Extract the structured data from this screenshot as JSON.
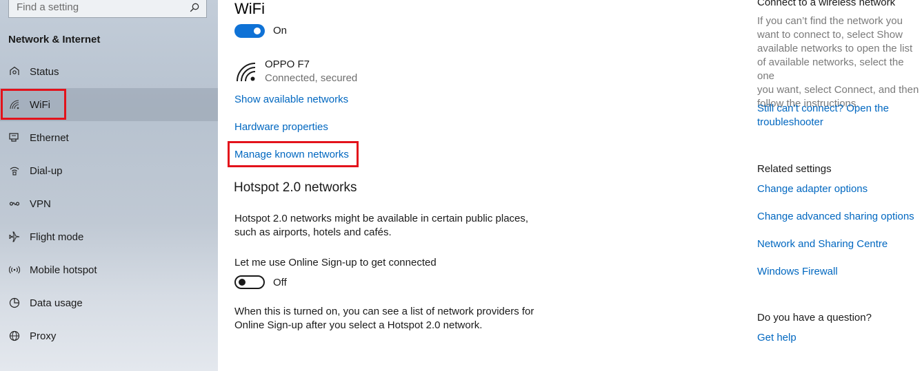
{
  "sidebar": {
    "search_placeholder": "Find a setting",
    "section_title": "Network & Internet",
    "items": [
      {
        "label": "Status",
        "icon": "home-status-icon"
      },
      {
        "label": "WiFi",
        "icon": "wifi-icon"
      },
      {
        "label": "Ethernet",
        "icon": "ethernet-icon"
      },
      {
        "label": "Dial-up",
        "icon": "dial-up-icon"
      },
      {
        "label": "VPN",
        "icon": "vpn-icon"
      },
      {
        "label": "Flight mode",
        "icon": "airplane-icon"
      },
      {
        "label": "Mobile hotspot",
        "icon": "hotspot-icon"
      },
      {
        "label": "Data usage",
        "icon": "data-usage-icon"
      },
      {
        "label": "Proxy",
        "icon": "globe-icon"
      }
    ],
    "selected": "WiFi"
  },
  "main": {
    "title": "WiFi",
    "wifi_toggle_label": "On",
    "network": {
      "name": "OPPO F7",
      "status": "Connected, secured"
    },
    "links": {
      "show_networks": "Show available networks",
      "hardware": "Hardware properties",
      "manage_known": "Manage known networks"
    },
    "hotspot": {
      "heading": "Hotspot 2.0 networks",
      "description_line1": "Hotspot 2.0 networks might be available in certain public places,",
      "description_line2": "such as airports, hotels and cafés.",
      "signup_label": "Let me use Online Sign-up to get connected",
      "signup_toggle_label": "Off",
      "note_line1": "When this is turned on, you can see a list of network providers for",
      "note_line2": "Online Sign-up after you select a Hotspot 2.0 network."
    }
  },
  "right": {
    "connect_heading": "Connect to a wireless network",
    "connect_text_lines": [
      "If you can’t find the network you",
      "want to connect to, select Show",
      "available networks to open the list",
      "of available networks, select the one",
      "you want, select Connect, and then",
      "follow the instructions."
    ],
    "troubleshoot_line1": "Still can’t connect? Open the",
    "troubleshoot_line2": "troubleshooter",
    "related_heading": "Related settings",
    "related_links": [
      "Change adapter options",
      "Change advanced sharing options",
      "Network and Sharing Centre",
      "Windows Firewall"
    ],
    "question_heading": "Do you have a question?",
    "get_help": "Get help"
  },
  "colors": {
    "accent": "#0067c0",
    "toggle_on": "#0f72d6",
    "highlight_box": "#e3121b"
  }
}
